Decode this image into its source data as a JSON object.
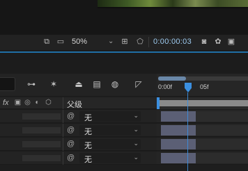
{
  "viewer_toolbar": {
    "zoom_value": "50%",
    "timecode": "0:00:00:03",
    "icons": [
      "region-icon",
      "monitor-icon",
      "zoom-dropdown-icon",
      "fit-icon",
      "mask-icon",
      "camera-icon",
      "color-icon",
      "channel-icon"
    ]
  },
  "timeline_toolbar": {
    "icons": [
      "draft-3d-icon",
      "shy-icon",
      "frame-blend-icon",
      "motion-blur-icon",
      "graph-editor-icon"
    ]
  },
  "ruler": {
    "labels": [
      "0:00f",
      "05f"
    ]
  },
  "layer_header": {
    "fx_label": "fx",
    "parent_label": "父级"
  },
  "layers": [
    {
      "parent_value": "无"
    },
    {
      "parent_value": "无"
    },
    {
      "parent_value": "无"
    },
    {
      "parent_value": "无"
    }
  ],
  "colors": {
    "accent": "#3b8fe0",
    "divider": "#1f6fa7",
    "clip": "#5b5f75"
  }
}
